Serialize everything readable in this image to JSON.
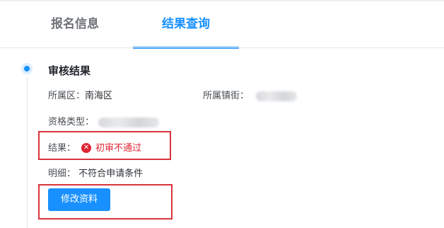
{
  "tabs": [
    {
      "label": "报名信息",
      "active": false
    },
    {
      "label": "结果查询",
      "active": true
    }
  ],
  "section": {
    "title": "审核结果"
  },
  "fields": {
    "district_label": "所属区：",
    "district_value": "南海区",
    "street_label": "所属镇街：",
    "qualification_label": "资格类型：",
    "result_label": "结果：",
    "result_value": "初审不通过",
    "detail_label": "明细：",
    "detail_value": "不符合申请条件"
  },
  "actions": {
    "edit_button": "修改资料"
  },
  "colors": {
    "accent": "#1890ff",
    "error": "#e02433",
    "annotation": "#d9343b"
  },
  "icons": {
    "result_status": "error-circle-icon"
  }
}
